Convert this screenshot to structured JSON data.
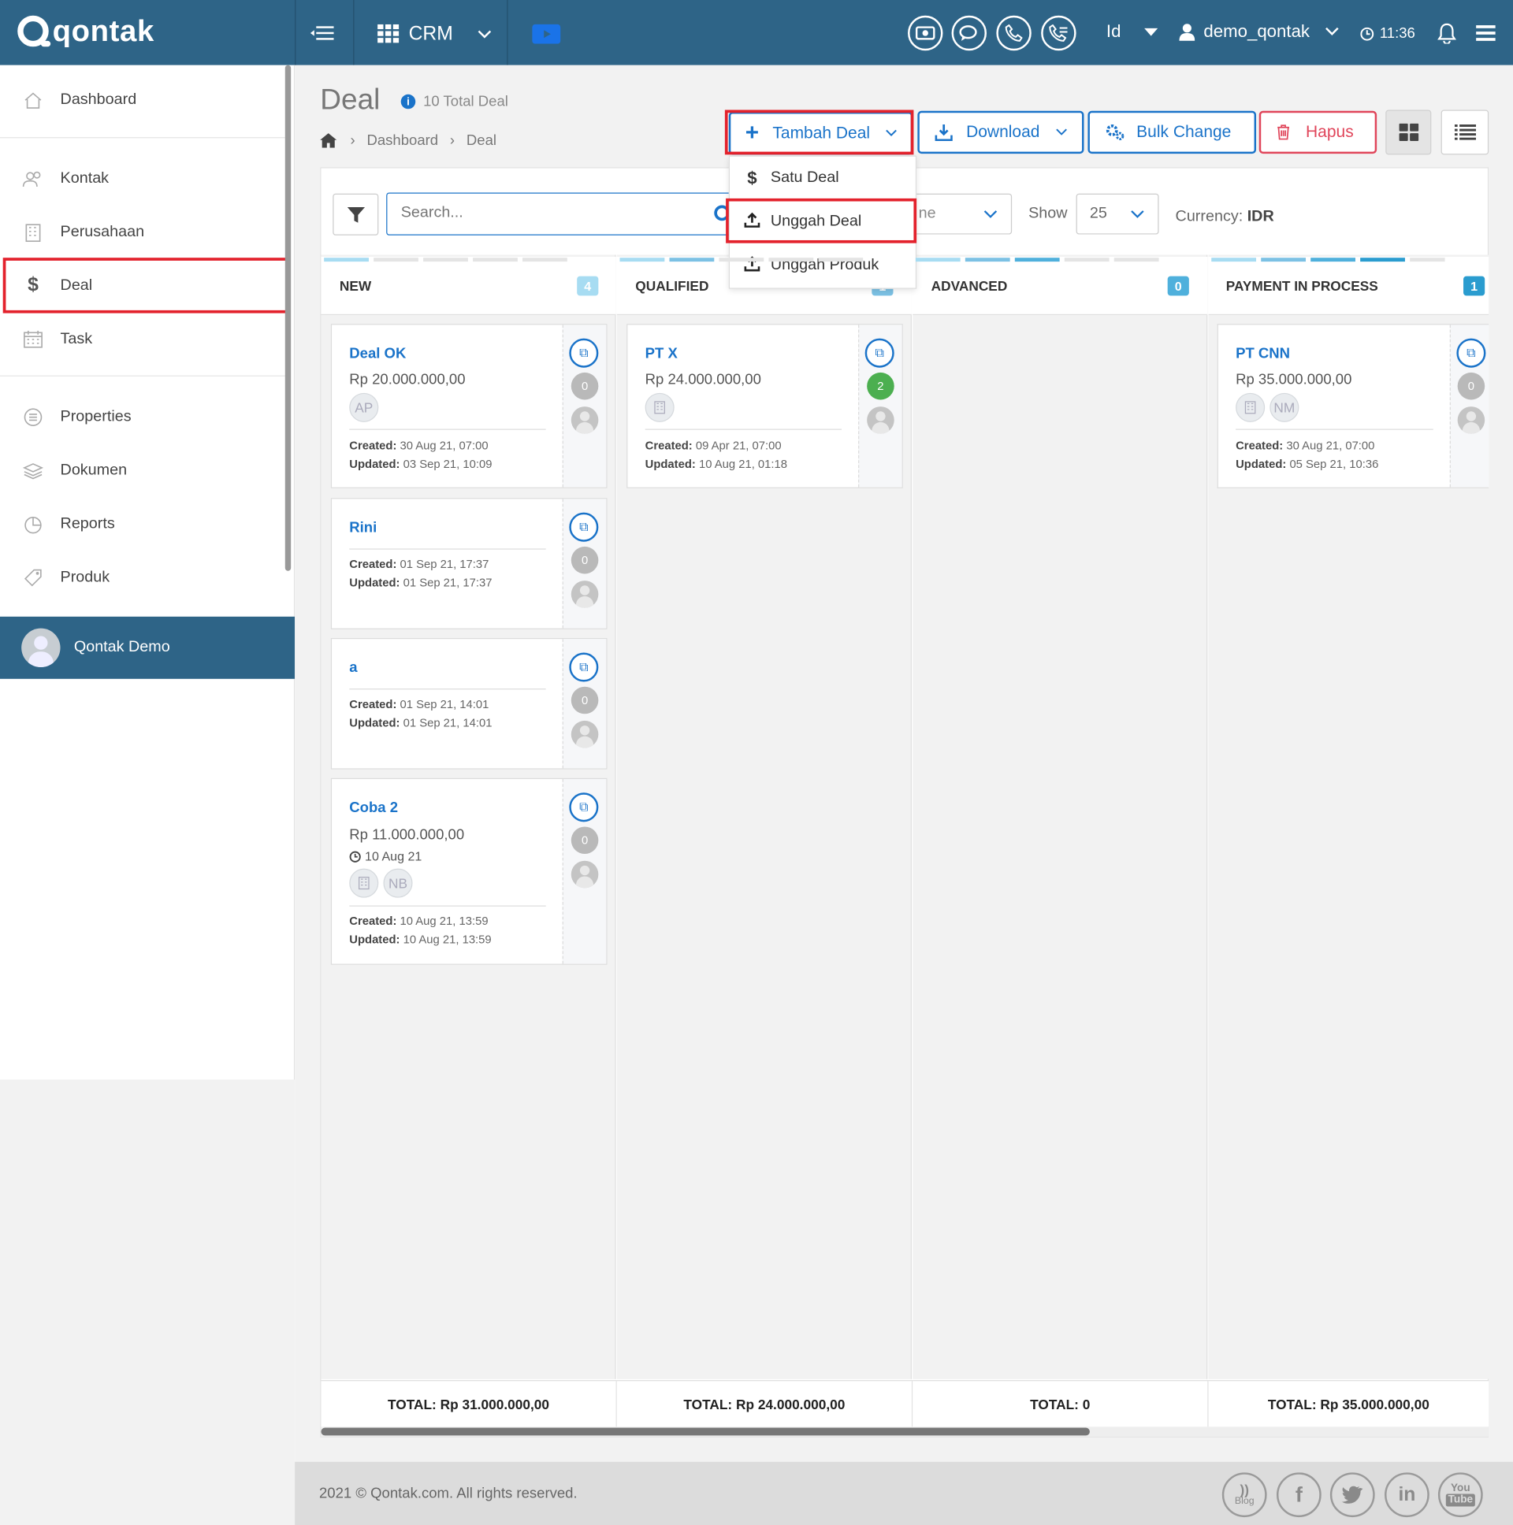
{
  "topbar": {
    "brand": "qontak",
    "app_label": "CRM",
    "lang": "Id",
    "username": "demo_qontak",
    "time": "11:36",
    "icons": [
      "menu-toggle-icon",
      "grid-icon",
      "video-icon",
      "cash-icon",
      "chat-icon",
      "phone-icon",
      "call-list-icon",
      "user-icon",
      "clock-icon",
      "bell-icon",
      "hamburger-icon"
    ]
  },
  "sidebar": {
    "items": [
      {
        "label": "Dashboard",
        "icon": "home-icon"
      },
      {
        "label": "Kontak",
        "icon": "people-icon"
      },
      {
        "label": "Perusahaan",
        "icon": "building-icon"
      },
      {
        "label": "Deal",
        "icon": "dollar-icon"
      },
      {
        "label": "Task",
        "icon": "calendar-icon"
      },
      {
        "label": "Properties",
        "icon": "list-icon"
      },
      {
        "label": "Dokumen",
        "icon": "layers-icon"
      },
      {
        "label": "Reports",
        "icon": "pie-chart-icon"
      },
      {
        "label": "Produk",
        "icon": "tag-icon"
      }
    ],
    "user": "Qontak Demo"
  },
  "page": {
    "title": "Deal",
    "total_deal": "10 Total Deal",
    "breadcrumb": [
      "Dashboard",
      "Deal"
    ]
  },
  "toolbar": {
    "add": "Tambah Deal",
    "download": "Download",
    "bulk": "Bulk Change",
    "delete": "Hapus"
  },
  "dropdown": {
    "items": [
      "Satu Deal",
      "Unggah Deal",
      "Unggah Produk"
    ]
  },
  "filters": {
    "search_placeholder": "Search...",
    "select_partial": "ne",
    "show_label": "Show",
    "show_value": "25",
    "currency_label": "Currency:",
    "currency_value": "IDR"
  },
  "columns": [
    {
      "name": "NEW",
      "count": "4",
      "total": "TOTAL: Rp 31.000.000,00",
      "badge_color": "#9fd6ef"
    },
    {
      "name": "QUALIFIED",
      "count": "1",
      "total": "TOTAL: Rp 24.000.000,00",
      "badge_color": "#7cc1e4"
    },
    {
      "name": "ADVANCED",
      "count": "0",
      "total": "TOTAL: 0",
      "badge_color": "#4fb0dc"
    },
    {
      "name": "PAYMENT IN PROCESS",
      "count": "1",
      "total": "TOTAL: Rp 35.000.000,00",
      "badge_color": "#2a9ccf"
    }
  ],
  "cards": {
    "c1": {
      "title": "Deal OK",
      "amount": "Rp 20.000.000,00",
      "chip": "AP",
      "created": "30 Aug 21, 07:00",
      "updated": "03 Sep 21, 10:09",
      "count": "0"
    },
    "c2": {
      "title": "Rini",
      "created": "01 Sep 21, 17:37",
      "updated": "01 Sep 21, 17:37",
      "count": "0"
    },
    "c3": {
      "title": "a",
      "created": "01 Sep 21, 14:01",
      "updated": "01 Sep 21, 14:01",
      "count": "0"
    },
    "c4": {
      "title": "Coba 2",
      "amount": "Rp 11.000.000,00",
      "date": "10 Aug 21",
      "chip": "NB",
      "created": "10 Aug 21, 13:59",
      "updated": "10 Aug 21, 13:59",
      "count": "0"
    },
    "c5": {
      "title": "PT X",
      "amount": "Rp 24.000.000,00",
      "created": "09 Apr 21, 07:00",
      "updated": "10 Aug 21, 01:18",
      "count": "2"
    },
    "c6": {
      "title": "PT CNN",
      "amount": "Rp 35.000.000,00",
      "chip": "NM",
      "created": "30 Aug 21, 07:00",
      "updated": "05 Sep 21, 10:36",
      "count": "0"
    }
  },
  "labels": {
    "created": "Created:",
    "updated": "Updated:"
  },
  "footer": {
    "copyright": "2021 © Qontak.com. All rights reserved.",
    "blog": "Blog",
    "social": [
      "blog-icon",
      "facebook-icon",
      "twitter-icon",
      "linkedin-icon",
      "youtube-icon"
    ]
  },
  "colors": {
    "brand": "#2e6487",
    "accent": "#1a73c9",
    "danger": "#e3222c"
  }
}
